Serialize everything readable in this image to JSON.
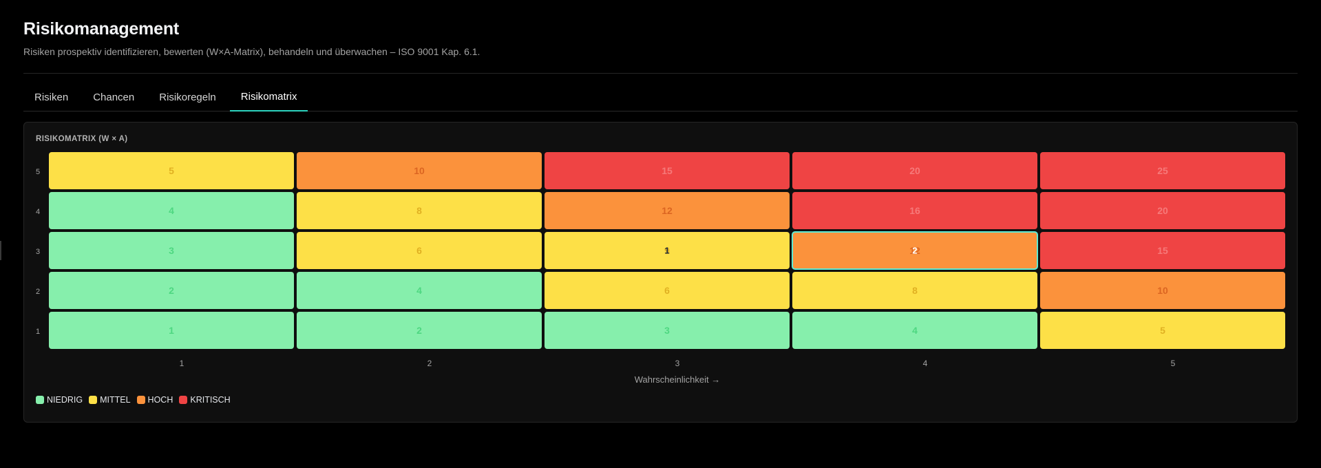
{
  "header": {
    "title": "Risikomanagement",
    "subtitle": "Risiken prospektiv identifizieren, bewerten (W×A-Matrix), behandeln und überwachen – ISO 9001 Kap. 6.1."
  },
  "tabs": [
    {
      "label": "Risiken",
      "active": false
    },
    {
      "label": "Chancen",
      "active": false
    },
    {
      "label": "Risikoregeln",
      "active": false
    },
    {
      "label": "Risikomatrix",
      "active": true
    }
  ],
  "matrix": {
    "title": "Risikomatrix (W × A)",
    "y_labels": [
      "5",
      "4",
      "3",
      "2",
      "1"
    ],
    "x_labels": [
      "1",
      "2",
      "3",
      "4",
      "5"
    ],
    "x_axis_title": "Wahrscheinlichkeit →",
    "rows": [
      [
        {
          "score": "5",
          "level": "mittel"
        },
        {
          "score": "10",
          "level": "hoch"
        },
        {
          "score": "15",
          "level": "kritisch"
        },
        {
          "score": "20",
          "level": "kritisch"
        },
        {
          "score": "25",
          "level": "kritisch"
        }
      ],
      [
        {
          "score": "4",
          "level": "niedrig"
        },
        {
          "score": "8",
          "level": "mittel"
        },
        {
          "score": "12",
          "level": "hoch"
        },
        {
          "score": "16",
          "level": "kritisch"
        },
        {
          "score": "20",
          "level": "kritisch"
        }
      ],
      [
        {
          "score": "3",
          "level": "niedrig"
        },
        {
          "score": "6",
          "level": "mittel"
        },
        {
          "score": "9",
          "level": "mittel",
          "count": "1"
        },
        {
          "score": "12",
          "level": "hoch",
          "count": "2",
          "selected": true
        },
        {
          "score": "15",
          "level": "kritisch"
        }
      ],
      [
        {
          "score": "2",
          "level": "niedrig"
        },
        {
          "score": "4",
          "level": "niedrig"
        },
        {
          "score": "6",
          "level": "mittel"
        },
        {
          "score": "8",
          "level": "mittel"
        },
        {
          "score": "10",
          "level": "hoch"
        }
      ],
      [
        {
          "score": "1",
          "level": "niedrig"
        },
        {
          "score": "2",
          "level": "niedrig"
        },
        {
          "score": "3",
          "level": "niedrig"
        },
        {
          "score": "4",
          "level": "niedrig"
        },
        {
          "score": "5",
          "level": "mittel"
        }
      ]
    ]
  },
  "legend": [
    {
      "label": "NIEDRIG",
      "color": "#86efac"
    },
    {
      "label": "MITTEL",
      "color": "#fde047"
    },
    {
      "label": "HOCH",
      "color": "#fb923c"
    },
    {
      "label": "KRITISCH",
      "color": "#ef4444"
    }
  ],
  "colors": {
    "accent": "#2dd4bf",
    "niedrig": "#86efac",
    "mittel": "#fde047",
    "hoch": "#fb923c",
    "kritisch": "#ef4444"
  }
}
